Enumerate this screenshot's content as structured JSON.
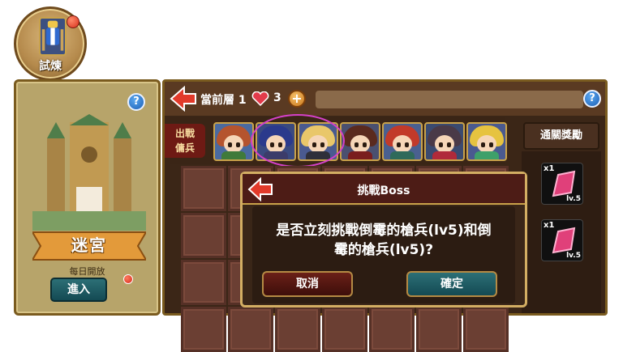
{
  "trial": {
    "label": "試煉"
  },
  "dungeon": {
    "title": "迷宮",
    "schedule": "每日開放",
    "enter_label": "進入"
  },
  "topbar": {
    "floor_text": "當前層 1",
    "lives": "3",
    "add_symbol": "+",
    "help_symbol": "?"
  },
  "party": {
    "deploy_label": "出戰\n傭兵",
    "heroes": [
      {
        "hair": "#b5542e",
        "body": "#3f7a3a",
        "bg": "#4a6aa0"
      },
      {
        "hair": "#2b3a8c",
        "body": "#3c3c6a",
        "bg": "#3a4a80"
      },
      {
        "hair": "#e9c76a",
        "body": "#2f2f3a",
        "bg": "#4a5a90"
      },
      {
        "hair": "#5a2a1e",
        "body": "#7a1e1e",
        "bg": "#4a5070"
      },
      {
        "hair": "#c23a2a",
        "body": "#2f6a5a",
        "bg": "#4a6090"
      },
      {
        "hair": "#4a3a48",
        "body": "#b02a3a",
        "bg": "#3a4a70"
      },
      {
        "hair": "#e6c340",
        "body": "#3ea06a",
        "bg": "#4a5a90"
      }
    ]
  },
  "rewards": {
    "header": "通關獎勵",
    "items": [
      {
        "qty": "x1",
        "level": "lv.5",
        "color": "#e0407a"
      },
      {
        "qty": "x1",
        "level": "lv.5",
        "color": "#e0407a"
      }
    ]
  },
  "dialog": {
    "title": "挑戰Boss",
    "message": "是否立刻挑戰倒霉的槍兵(lv5)和倒霉的槍兵(lv5)?",
    "cancel_label": "取消",
    "confirm_label": "確定"
  },
  "colors": {
    "accent": "#d3ae63",
    "confirm": "#1e5a63",
    "cancel": "#5a1a14"
  }
}
